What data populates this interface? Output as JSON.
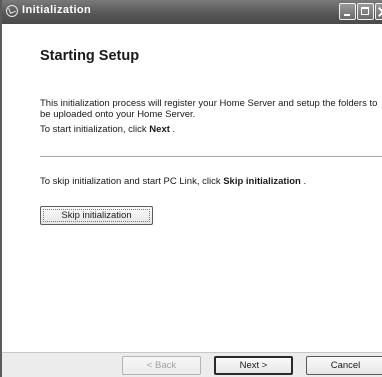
{
  "window": {
    "title": "Initialization"
  },
  "page": {
    "heading": "Starting Setup",
    "intro": "This initialization process will register your Home Server and setup the folders to be uploaded onto your Home Server.",
    "start_prefix": "To start initialization, click ",
    "start_emphasis": "Next",
    "start_suffix": " .",
    "skip_prefix": "To skip initialization and start PC Link, click ",
    "skip_emphasis": "Skip initialization",
    "skip_suffix": " .",
    "skip_button_label": "Skip initialization"
  },
  "footer": {
    "back_label": "< Back",
    "next_label": "Next >",
    "cancel_label": "Cancel"
  },
  "icons": {
    "title_icon": "setup-icon",
    "minimize": "minimize-icon",
    "maximize": "maximize-icon",
    "close": "close-icon"
  }
}
